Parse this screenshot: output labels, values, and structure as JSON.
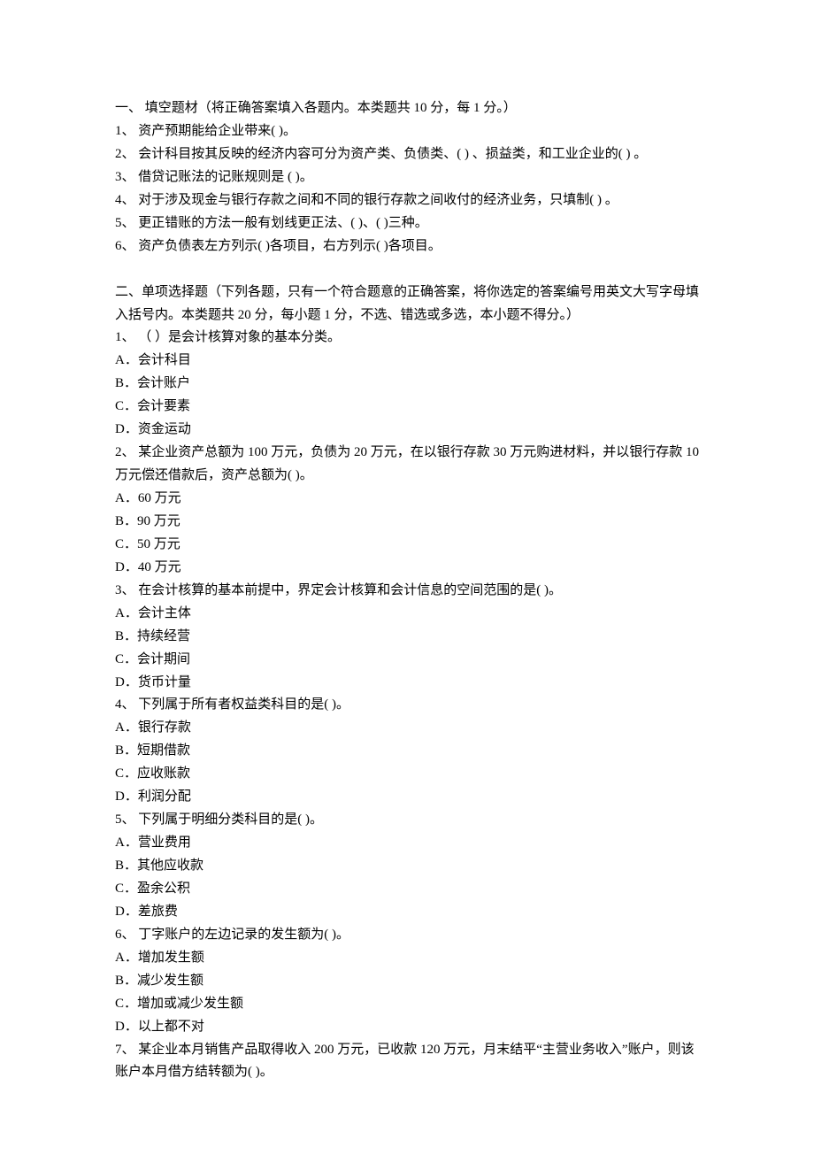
{
  "section1": {
    "header": "一、 填空题材（将正确答案填入各题内。本类题共 10 分，每 1 分。）",
    "items": [
      "1、 资产预期能给企业带来(  )。",
      "2、 会计科目按其反映的经济内容可分为资产类、负债类、(  ) 、损益类，和工业企业的(  ) 。",
      "3、 借贷记账法的记账规则是 (  )。",
      "4、 对于涉及现金与银行存款之间和不同的银行存款之间收付的经济业务，只填制(  ) 。",
      "5、 更正错账的方法一般有划线更正法、(  )、(  )三种。",
      "6、 资产负债表左方列示(  )各项目，右方列示(  )各项目。"
    ]
  },
  "section2": {
    "header": "二、单项选择题（下列各题，只有一个符合题意的正确答案，将你选定的答案编号用英文大写字母填入括号内。本类题共 20 分，每小题 1 分，不选、错选或多选，本小题不得分。）",
    "questions": [
      {
        "stem": "1、 （ ）是会计核算对象的基本分类。",
        "opts": [
          "A．会计科目",
          "B．会计账户",
          "C．会计要素",
          "D．资金运动"
        ]
      },
      {
        "stem": "2、 某企业资产总额为 100 万元，负债为 20 万元，在以银行存款 30 万元购进材料，并以银行存款 10 万元偿还借款后，资产总额为( )。",
        "opts": [
          "A．60 万元",
          "B．90 万元",
          "C．50 万元",
          "D．40 万元"
        ]
      },
      {
        "stem": "3、 在会计核算的基本前提中，界定会计核算和会计信息的空间范围的是( )。",
        "opts": [
          "A．会计主体",
          "B．持续经营",
          "C．会计期间",
          "D．货币计量"
        ]
      },
      {
        "stem": "4、 下列属于所有者权益类科目的是( )。",
        "opts": [
          "A．银行存款",
          "B．短期借款",
          "C．应收账款",
          "D．利润分配"
        ]
      },
      {
        "stem": "5、 下列属于明细分类科目的是( )。",
        "opts": [
          "A．营业费用",
          "B．其他应收款",
          "C．盈余公积",
          "D．差旅费"
        ]
      },
      {
        "stem": "6、 丁字账户的左边记录的发生额为( )。",
        "opts": [
          "A．增加发生额",
          "B．减少发生额",
          "C．增加或减少发生额",
          "D．以上都不对"
        ]
      },
      {
        "stem": "7、 某企业本月销售产品取得收入 200 万元，已收款 120 万元，月末结平“主营业务收入”账户，则该账户本月借方结转额为( )。",
        "opts": []
      }
    ]
  }
}
